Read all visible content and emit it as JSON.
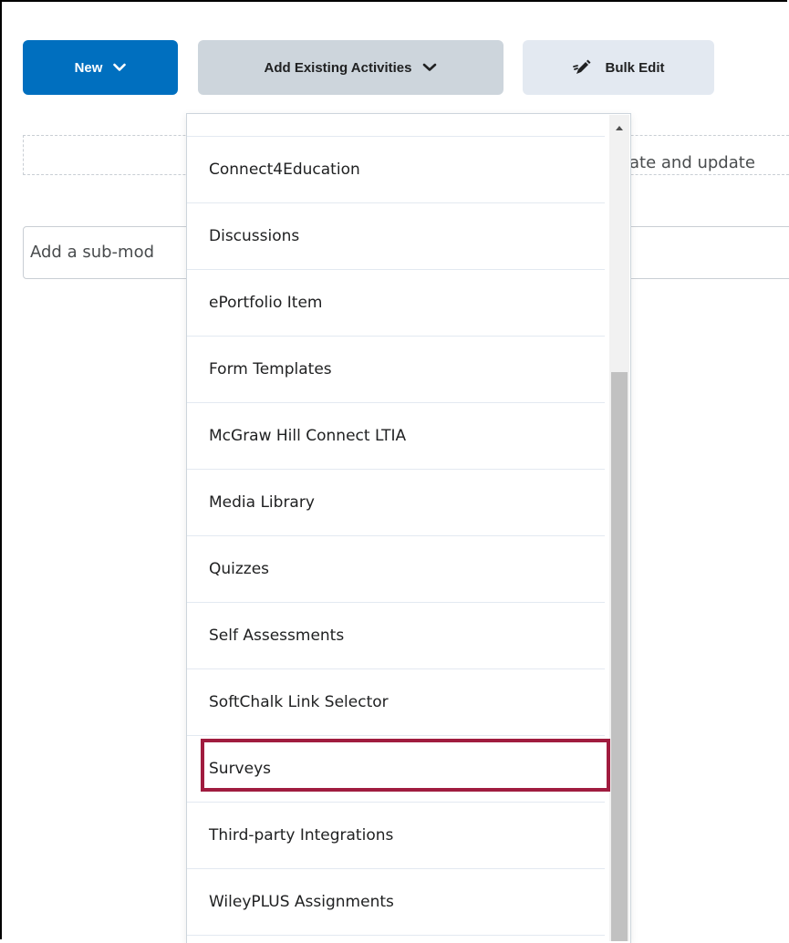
{
  "toolbar": {
    "new_label": "New",
    "add_existing_label": "Add Existing Activities",
    "bulk_edit_label": "Bulk Edit"
  },
  "dashed_area": {
    "partial_text": "ate and update"
  },
  "sub_module": {
    "placeholder_partial": "Add a sub-mod"
  },
  "dropdown": {
    "items": [
      "Connect4Education",
      "Discussions",
      "ePortfolio Item",
      "Form Templates",
      "McGraw Hill Connect LTIA",
      "Media Library",
      "Quizzes",
      "Self Assessments",
      "SoftChalk Link Selector",
      "Surveys",
      "Third-party Integrations",
      "WileyPLUS Assignments"
    ],
    "highlighted_item": "Third-party Integrations"
  },
  "colors": {
    "primary": "#006fbf",
    "highlight_border": "#a01c3f"
  }
}
